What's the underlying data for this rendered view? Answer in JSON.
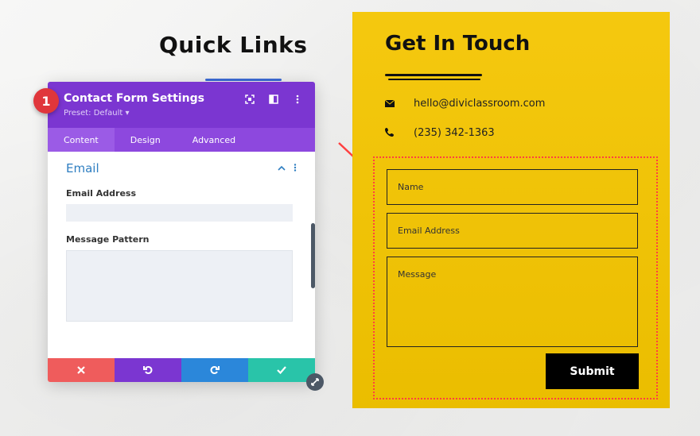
{
  "left_heading": "Quick Links",
  "panel": {
    "badge": "1",
    "title": "Contact Form Settings",
    "preset": "Preset: Default ▾",
    "tabs": [
      {
        "label": "Content",
        "active": true
      },
      {
        "label": "Design",
        "active": false
      },
      {
        "label": "Advanced",
        "active": false
      }
    ],
    "section_title": "Email",
    "email_label": "Email Address",
    "message_label": "Message Pattern",
    "email_value": "",
    "message_value": "",
    "footer": {
      "cancel_color": "#ef5c5c",
      "undo_color": "#7b36d1",
      "redo_color": "#2b87da",
      "save_color": "#29c4a9"
    }
  },
  "card": {
    "title": "Get In Touch",
    "email": "hello@diviclassroom.com",
    "phone": "(235) 342-1363",
    "fields": {
      "name": "Name",
      "email": "Email Address",
      "message": "Message"
    },
    "submit": "Submit"
  },
  "colors": {
    "accent": "#7b36d1",
    "card_bg": "#f4c500",
    "highlight": "#ff4040"
  }
}
